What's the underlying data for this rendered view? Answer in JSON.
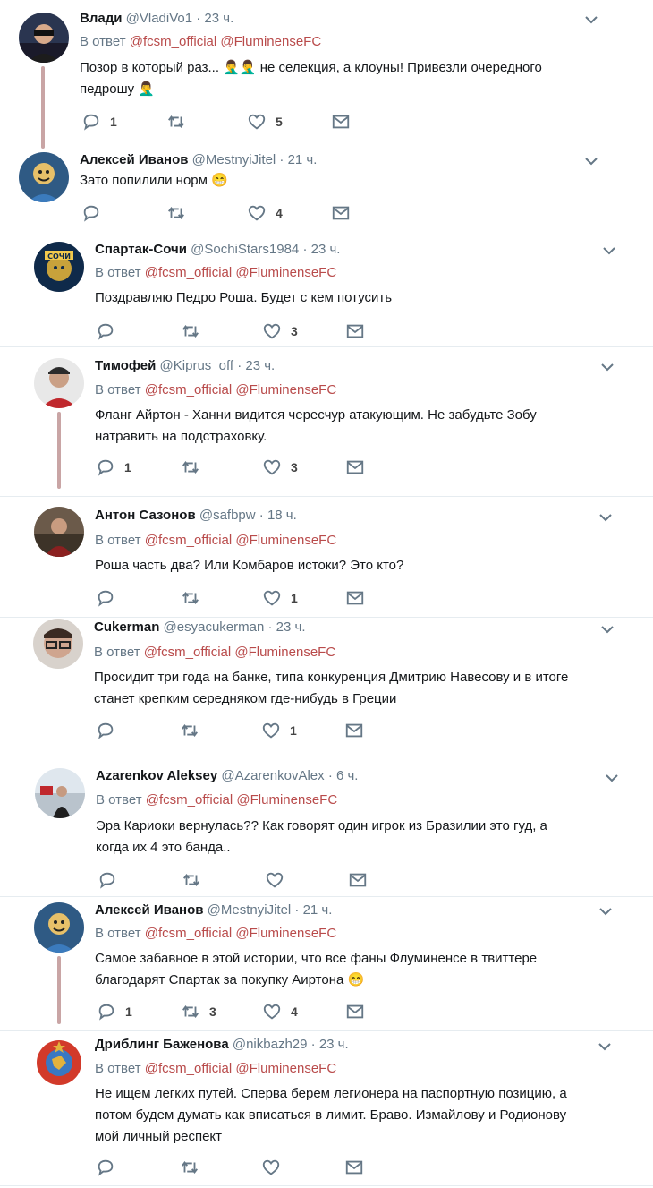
{
  "reply_prefix": "В ответ",
  "tweets": [
    {
      "name": "Влади",
      "handle": "@VladiVo1",
      "time": "· 23 ч.",
      "reply_to": [
        "@fcsm_official",
        "@FluminenseFC"
      ],
      "text_lines": [
        "Позор в который раз... 🤦‍♂️🤦‍♂️ не селекция, а клоуны! Привезли очередного",
        "педрошу 🤦‍♂️"
      ],
      "replies": "1",
      "retweets": "",
      "likes": "5"
    },
    {
      "name": "Алексей Иванов",
      "handle": "@MestnyiJitel",
      "time": "· 21 ч.",
      "reply_to": [],
      "text_lines": [
        "Зато попилили норм 😁"
      ],
      "replies": "",
      "retweets": "",
      "likes": "4"
    },
    {
      "name": "Спартак-Сочи",
      "handle": "@SochiStars1984",
      "time": "· 23 ч.",
      "reply_to": [
        "@fcsm_official",
        "@FluminenseFC"
      ],
      "text_lines": [
        "Поздравляю Педро Роша. Будет с кем потусить"
      ],
      "replies": "",
      "retweets": "",
      "likes": "3"
    },
    {
      "name": "Тимофей",
      "handle": "@Kiprus_off",
      "time": "· 23 ч.",
      "reply_to": [
        "@fcsm_official",
        "@FluminenseFC"
      ],
      "text_lines": [
        "Фланг Айртон - Ханни видится чересчур атакующим. Не забудьте Зобу",
        "натравить на подстраховку."
      ],
      "replies": "1",
      "retweets": "",
      "likes": "3"
    },
    {
      "name": "Антон Сазонов",
      "handle": "@safbpw",
      "time": "· 18 ч.",
      "reply_to": [
        "@fcsm_official",
        "@FluminenseFC"
      ],
      "text_lines": [
        "Роша часть два? Или Комбаров истоки? Это кто?"
      ],
      "replies": "",
      "retweets": "",
      "likes": "1"
    },
    {
      "name": "Cukerman",
      "handle": "@esyacukerman",
      "time": "· 23 ч.",
      "reply_to": [
        "@fcsm_official",
        "@FluminenseFC"
      ],
      "text_lines": [
        "Просидит три года на банке, типа конкуренция Дмитрию Навесову и в итоге",
        "станет крепким середняком где-нибудь в Греции"
      ],
      "replies": "",
      "retweets": "",
      "likes": "1"
    },
    {
      "name": "Azarenkov Aleksey",
      "handle": "@AzarenkovAlex",
      "time": "· 6 ч.",
      "reply_to": [
        "@fcsm_official",
        "@FluminenseFC"
      ],
      "text_lines": [
        "Эра Кариоки вернулась??  Как говорят один игрок из Бразилии это гуд, а",
        "когда их 4 это банда.."
      ],
      "replies": "",
      "retweets": "",
      "likes": ""
    },
    {
      "name": "Алексей Иванов",
      "handle": "@MestnyiJitel",
      "time": "· 21 ч.",
      "reply_to": [
        "@fcsm_official",
        "@FluminenseFC"
      ],
      "text_lines": [
        "Самое забавное в этой истории, что все фаны Флуминенсе в твиттере",
        "благодарят Спартак за покупку Аиртона 😁"
      ],
      "replies": "1",
      "retweets": "3",
      "likes": "4"
    },
    {
      "name": "Дриблинг Баженова",
      "handle": "@nikbazh29",
      "time": "· 23 ч.",
      "reply_to": [
        "@fcsm_official",
        "@FluminenseFC"
      ],
      "text_lines": [
        "Не ищем легких путей. Сперва берем легионера на паспортную позицию, а",
        "потом будем думать как вписаться в лимит. Браво. Измайлову и Родионову",
        "мой личный респект"
      ],
      "replies": "",
      "retweets": "",
      "likes": ""
    }
  ]
}
